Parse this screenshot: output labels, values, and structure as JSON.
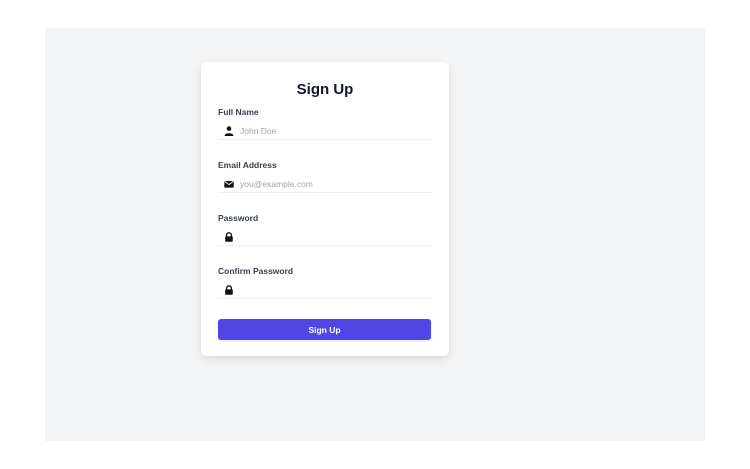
{
  "form": {
    "title": "Sign Up",
    "fields": [
      {
        "label": "Full Name",
        "placeholder": "John Doe",
        "value": "",
        "icon": "user-icon"
      },
      {
        "label": "Email Address",
        "placeholder": "you@example.com",
        "value": "",
        "icon": "envelope-icon"
      },
      {
        "label": "Password",
        "placeholder": "",
        "value": "",
        "icon": "lock-icon"
      },
      {
        "label": "Confirm Password",
        "placeholder": "",
        "value": "",
        "icon": "lock-icon"
      }
    ],
    "submit_label": "Sign Up"
  },
  "colors": {
    "page_background": "#f3f4f6",
    "card_background": "#ffffff",
    "accent": "#4f46e5",
    "label_text": "#374151",
    "placeholder_text": "#9ca3af"
  }
}
